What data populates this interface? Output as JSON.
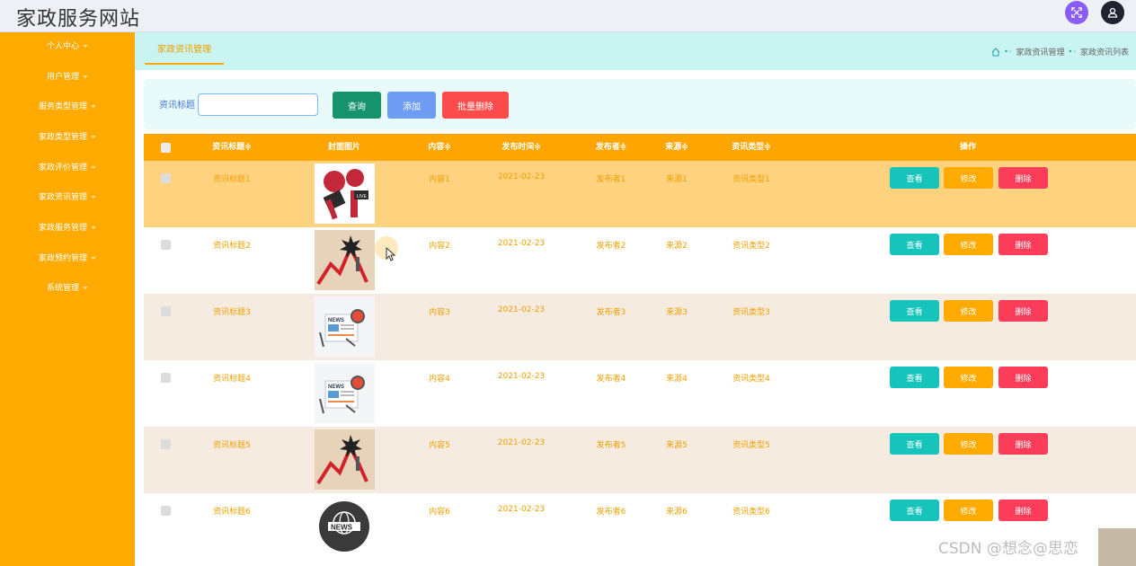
{
  "header": {
    "title": "家政服务网站"
  },
  "sidebar": {
    "items": [
      {
        "label": "个人中心"
      },
      {
        "label": "用户管理"
      },
      {
        "label": "服务类型管理"
      },
      {
        "label": "家政类型管理"
      },
      {
        "label": "家政评价管理"
      },
      {
        "label": "家政资讯管理"
      },
      {
        "label": "家政服务管理"
      },
      {
        "label": "家政预约管理"
      },
      {
        "label": "系统管理"
      }
    ]
  },
  "tab": {
    "label": "家政资讯管理"
  },
  "breadcrumb": {
    "items": [
      "家政资讯管理",
      "家政资讯列表"
    ]
  },
  "search": {
    "label": "资讯标题",
    "value": "",
    "query_label": "查询",
    "add_label": "添加",
    "batch_delete_label": "批量删除"
  },
  "table": {
    "columns": [
      "资讯标题",
      "封面图片",
      "内容",
      "发布时间",
      "发布者",
      "来源",
      "资讯类型",
      "操作"
    ],
    "sortable": [
      "资讯标题",
      "内容",
      "发布时间",
      "发布者",
      "来源",
      "资讯类型"
    ],
    "actions": {
      "view": "查看",
      "edit": "修改",
      "delete": "删除"
    },
    "rows": [
      {
        "title": "资讯标题1",
        "cover": "live-microphone",
        "content": "内容1",
        "date": "2021-02-23",
        "publisher": "发布者1",
        "source": "来源1",
        "type": "资讯类型1"
      },
      {
        "title": "资讯标题2",
        "cover": "market-crash-chart",
        "content": "内容2",
        "date": "2021-02-23",
        "publisher": "发布者2",
        "source": "来源2",
        "type": "资讯类型2"
      },
      {
        "title": "资讯标题3",
        "cover": "news-paper-loupe",
        "content": "内容3",
        "date": "2021-02-23",
        "publisher": "发布者3",
        "source": "来源3",
        "type": "资讯类型3"
      },
      {
        "title": "资讯标题4",
        "cover": "news-paper-loupe",
        "content": "内容4",
        "date": "2021-02-23",
        "publisher": "发布者4",
        "source": "来源4",
        "type": "资讯类型4"
      },
      {
        "title": "资讯标题5",
        "cover": "market-crash-chart",
        "content": "内容5",
        "date": "2021-02-23",
        "publisher": "发布者5",
        "source": "来源5",
        "type": "资讯类型5"
      },
      {
        "title": "资讯标题6",
        "cover": "news-globe-badge",
        "content": "内容6",
        "date": "2021-02-23",
        "publisher": "发布者6",
        "source": "来源6",
        "type": "资讯类型6"
      }
    ],
    "row_colors": [
      "#ffd27f",
      "#ffffff",
      "#f5ebe0",
      "#ffffff",
      "#f5ebe0",
      "#ffffff"
    ]
  },
  "watermark": "CSDN @想念@思恋",
  "colors": {
    "accent": "#ffaa00",
    "tab_bg": "#c9f4f2",
    "view": "#17c4bb",
    "delete": "#fb3d5a"
  }
}
